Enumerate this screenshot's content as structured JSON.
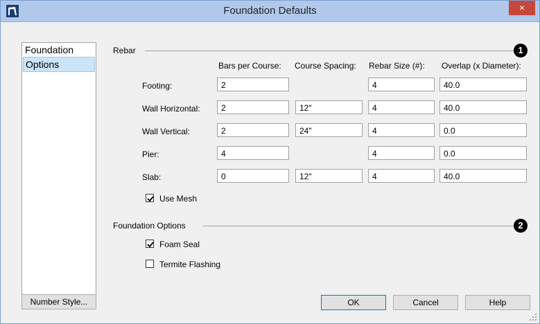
{
  "window": {
    "title": "Foundation Defaults",
    "close_label": "×"
  },
  "nav": {
    "items": [
      "Foundation",
      "Options"
    ]
  },
  "rebar": {
    "group_label": "Rebar",
    "badge": "1",
    "columns": [
      "Bars per Course:",
      "Course Spacing:",
      "Rebar Size (#):",
      "Overlap (x Diameter):"
    ],
    "rows": [
      {
        "label": "Footing:",
        "bars": "2",
        "spacing": null,
        "size": "4",
        "overlap": "40.0"
      },
      {
        "label": "Wall Horizontal:",
        "bars": "2",
        "spacing": "12\"",
        "size": "4",
        "overlap": "40.0"
      },
      {
        "label": "Wall Vertical:",
        "bars": "2",
        "spacing": "24\"",
        "size": "4",
        "overlap": "0.0"
      },
      {
        "label": "Pier:",
        "bars": "4",
        "spacing": null,
        "size": "4",
        "overlap": "0.0"
      },
      {
        "label": "Slab:",
        "bars": "0",
        "spacing": "12\"",
        "size": "4",
        "overlap": "40.0"
      }
    ],
    "use_mesh": {
      "label": "Use Mesh",
      "checked": true
    }
  },
  "foundation_options": {
    "group_label": "Foundation Options",
    "badge": "2",
    "foam_seal": {
      "label": "Foam Seal",
      "checked": true
    },
    "termite_flashing": {
      "label": "Termite Flashing",
      "checked": false
    }
  },
  "buttons": {
    "number_style": "Number Style...",
    "ok": "OK",
    "cancel": "Cancel",
    "help": "Help"
  },
  "colors": {
    "title_bar": "#b0c8ea",
    "close_button": "#c7463e",
    "selection": "#cce4f7",
    "default_button_border": "#0078d7"
  },
  "icons": {
    "app": "app-icon",
    "close": "close-icon",
    "check": "checkmark-icon",
    "grip": "resize-grip-icon"
  }
}
